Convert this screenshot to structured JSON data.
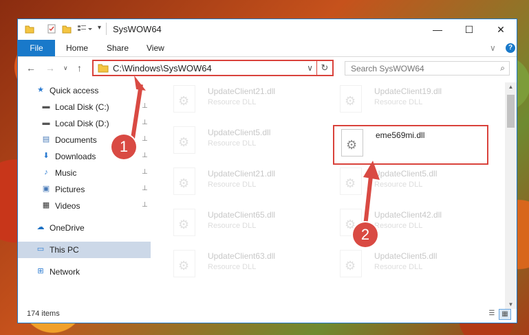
{
  "window": {
    "title": "SysWOW64",
    "minimize": "—",
    "maximize": "☐",
    "close": "✕"
  },
  "ribbon": {
    "tabs": [
      "File",
      "Home",
      "Share",
      "View"
    ],
    "expand": "∨",
    "help": "?"
  },
  "navigation": {
    "back": "←",
    "forward": "→",
    "recent": "∨",
    "up": "↑",
    "address": "C:\\Windows\\SysWOW64",
    "address_dropdown": "∨",
    "refresh": "↻",
    "search_placeholder": "Search SysWOW64",
    "search_icon": "⌕"
  },
  "sidebar": {
    "items": [
      {
        "label": "Quick access",
        "icon": "star-icon",
        "glyph": "★",
        "color": "#2b7bd1"
      },
      {
        "label": "Local Disk (C:)",
        "icon": "drive-icon",
        "glyph": "▬",
        "color": "#555555",
        "pinned": true
      },
      {
        "label": "Local Disk (D:)",
        "icon": "drive-icon",
        "glyph": "▬",
        "color": "#555555",
        "pinned": true
      },
      {
        "label": "Documents",
        "icon": "documents-icon",
        "glyph": "▤",
        "color": "#4a7bb8",
        "pinned": true
      },
      {
        "label": "Downloads",
        "icon": "download-icon",
        "glyph": "⬇",
        "color": "#2b7bd1",
        "pinned": true
      },
      {
        "label": "Music",
        "icon": "music-icon",
        "glyph": "♪",
        "color": "#2b7bd1",
        "pinned": true
      },
      {
        "label": "Pictures",
        "icon": "pictures-icon",
        "glyph": "▣",
        "color": "#4a7bb8",
        "pinned": true
      },
      {
        "label": "Videos",
        "icon": "video-icon",
        "glyph": "▦",
        "color": "#333333",
        "pinned": true
      },
      {
        "label": "OneDrive",
        "icon": "cloud-icon",
        "glyph": "☁",
        "color": "#1a6fc2"
      },
      {
        "label": "This PC",
        "icon": "computer-icon",
        "glyph": "▭",
        "color": "#2b7bd1",
        "selected": true
      },
      {
        "label": "Network",
        "icon": "network-icon",
        "glyph": "⊞",
        "color": "#2b7bd1"
      }
    ],
    "pin_glyph": "📌"
  },
  "files": [
    {
      "name": "UpdateClient21.dll",
      "type": "Resource DLL",
      "faded": true
    },
    {
      "name": "UpdateClient19.dll",
      "type": "Resource DLL",
      "faded": true
    },
    {
      "name": "UpdateClient5.dll",
      "type": "Resource DLL",
      "faded": true
    },
    {
      "name": "eme569mi.dll",
      "type": "",
      "faded": false,
      "highlight": true
    },
    {
      "name": "UpdateClient21.dll",
      "type": "Resource DLL",
      "faded": true
    },
    {
      "name": "UpdateClient5.dll",
      "type": "Resource DLL",
      "faded": true
    },
    {
      "name": "UpdateClient65.dll",
      "type": "Resource DLL",
      "faded": true
    },
    {
      "name": "UpdateClient42.dll",
      "type": "Resource DLL",
      "faded": true
    },
    {
      "name": "UpdateClient63.dll",
      "type": "Resource DLL",
      "faded": true
    },
    {
      "name": "UpdateClient5.dll",
      "type": "Resource DLL",
      "faded": true
    }
  ],
  "status": {
    "count": "174 items"
  },
  "callouts": [
    "1",
    "2"
  ],
  "colors": {
    "accent": "#1979ca",
    "highlight": "#d9423b",
    "callout": "#d94a43"
  }
}
